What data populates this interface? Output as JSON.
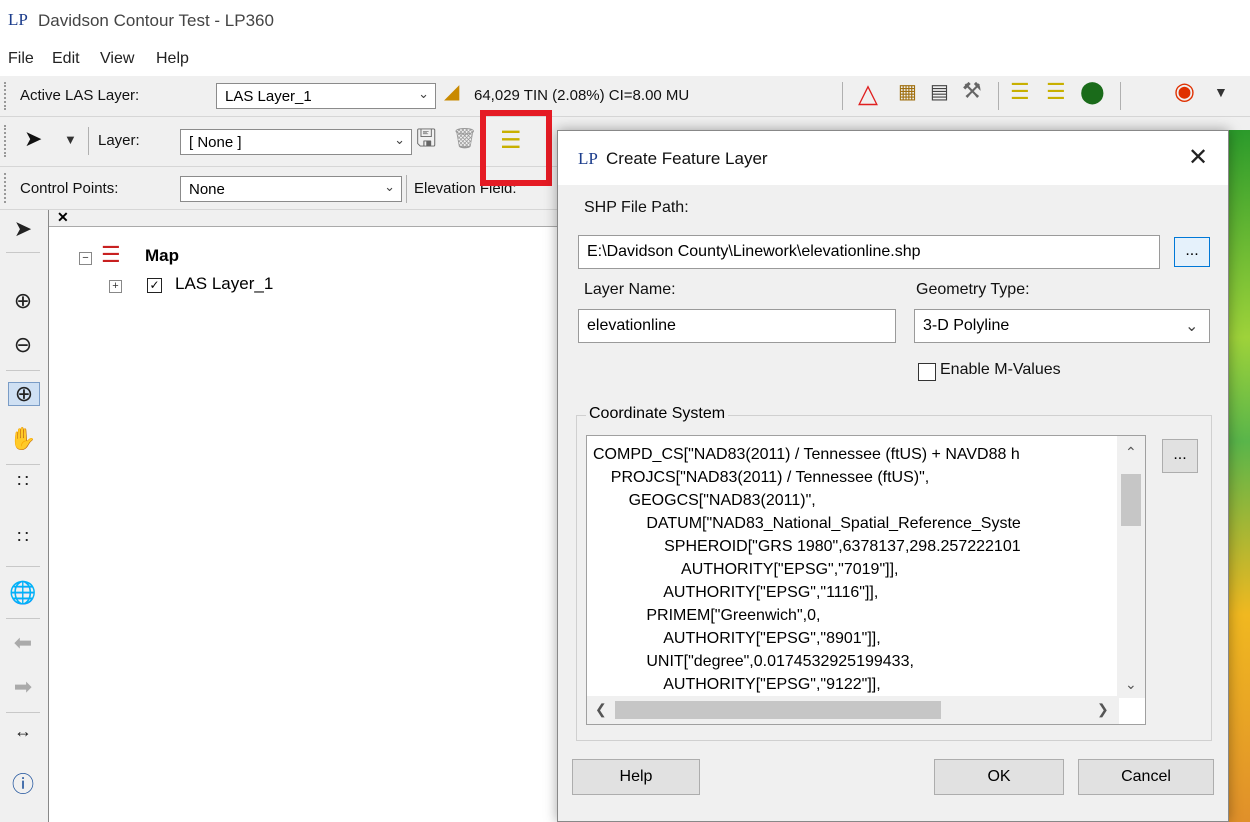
{
  "app": {
    "logo": "LP",
    "title": "Davidson Contour Test - LP360"
  },
  "menu": [
    "File",
    "Edit",
    "View",
    "Help"
  ],
  "toolbar1": {
    "active_las_label": "Active LAS Layer:",
    "active_las_value": "LAS Layer_1",
    "tin_info": "64,029 TIN (2.08%) CI=8.00 MU"
  },
  "toolbar2": {
    "layer_label": "Layer:",
    "layer_value": "[ None ]"
  },
  "toolbar3": {
    "control_points_label": "Control Points:",
    "control_points_value": "None",
    "elevation_field_label": "Elevation Field:"
  },
  "tree": {
    "root": "Map",
    "child": "LAS Layer_1"
  },
  "dialog": {
    "logo": "LP",
    "title": "Create Feature Layer",
    "close_glyph": "✕",
    "shp_label": "SHP File Path:",
    "shp_value": "E:\\Davidson County\\Linework\\elevationline.shp",
    "browse_label": "...",
    "layer_name_label": "Layer Name:",
    "layer_name_value": "elevationline",
    "geometry_label": "Geometry Type:",
    "geometry_value": "3-D Polyline",
    "enable_m_label": "Enable M-Values",
    "coord_group_label": "Coordinate System",
    "coord_browse_label": "...",
    "coord_lines": [
      "COMPD_CS[\"NAD83(2011) / Tennessee (ftUS) + NAVD88 h",
      "    PROJCS[\"NAD83(2011) / Tennessee (ftUS)\",",
      "        GEOGCS[\"NAD83(2011)\",",
      "            DATUM[\"NAD83_National_Spatial_Reference_Syste",
      "                SPHEROID[\"GRS 1980\",6378137,298.257222101",
      "                    AUTHORITY[\"EPSG\",\"7019\"]],",
      "                AUTHORITY[\"EPSG\",\"1116\"]],",
      "            PRIMEM[\"Greenwich\",0,",
      "                AUTHORITY[\"EPSG\",\"8901\"]],",
      "            UNIT[\"degree\",0.0174532925199433,",
      "                AUTHORITY[\"EPSG\",\"9122\"]],"
    ],
    "help_label": "Help",
    "ok_label": "OK",
    "cancel_label": "Cancel"
  },
  "colors": {
    "highlight": "#e51b24",
    "accent": "#0078d7",
    "toolbar_bg": "#f0f0f0"
  },
  "icons": {
    "select_tool": "select-arrow-icon",
    "zoom_in": "zoom-in-icon",
    "zoom_out": "zoom-out-icon",
    "pan": "pan-hand-icon",
    "full_extent": "globe-icon",
    "info": "info-icon"
  }
}
